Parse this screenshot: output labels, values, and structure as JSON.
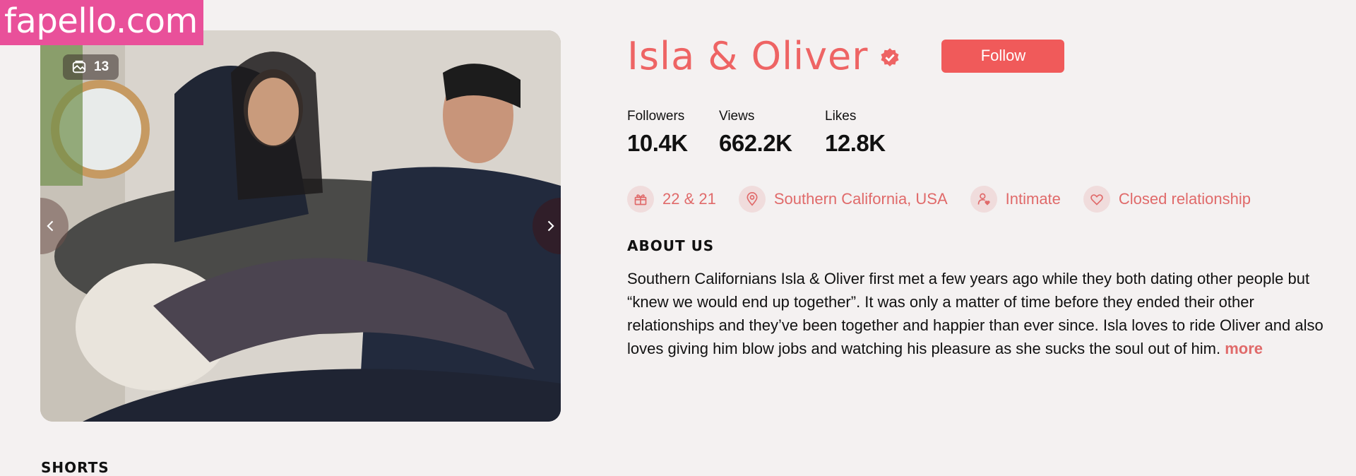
{
  "watermark": "fapello.com",
  "gallery": {
    "image_count": "13"
  },
  "profile": {
    "name": "Isla & Oliver",
    "follow_label": "Follow",
    "stats": [
      {
        "label": "Followers",
        "value": "10.4K"
      },
      {
        "label": "Views",
        "value": "662.2K"
      },
      {
        "label": "Likes",
        "value": "12.8K"
      }
    ],
    "tags": [
      {
        "icon": "gift-icon",
        "text": "22 & 21"
      },
      {
        "icon": "location-pin-icon",
        "text": "Southern California, USA"
      },
      {
        "icon": "user-heart-icon",
        "text": "Intimate"
      },
      {
        "icon": "heart-icon",
        "text": "Closed relationship"
      }
    ],
    "about_title": "ABOUT US",
    "about_text": "Southern Californians Isla & Oliver first met a few years ago while they both dating other people but “knew we would end up together”. It was only a matter of time before they ended their other relationships and they’ve been together and happier than ever since. Isla loves to ride Oliver and also loves giving him blow jobs and watching his pleasure as she sucks the soul out of him.",
    "more_label": "more"
  },
  "shorts_title": "SHORTS",
  "colors": {
    "accent": "#ee6464",
    "follow_button": "#f05a5a",
    "watermark_bg": "#e9509a",
    "tag_icon_bg": "#f0dcdc",
    "page_bg": "#f4f1f1"
  }
}
